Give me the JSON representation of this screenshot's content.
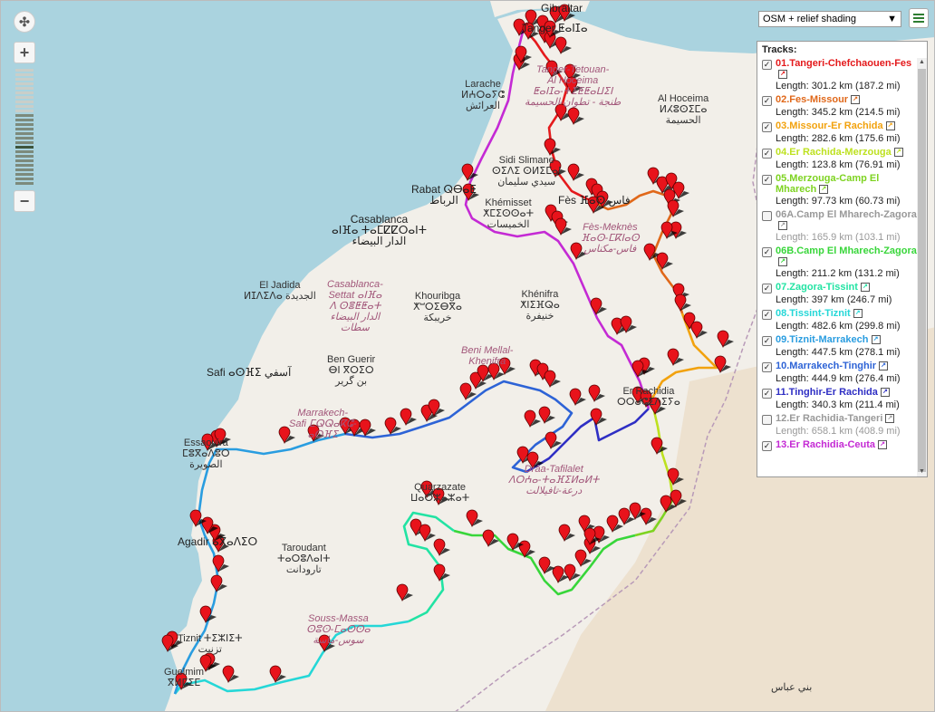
{
  "map": {
    "layer_select": "OSM + relief shading",
    "colors": {
      "sea": "#aad3df",
      "land": "#f2efe9",
      "desert": "#ebdcc3",
      "border": "#b89ab8"
    },
    "places": [
      {
        "name": "Gibraltar",
        "cls": "big"
      },
      {
        "name": "Tanger ⵟⴰⵏⵊⴰ",
        "cls": "big"
      },
      {
        "name": "Larache\nⵍⵄⵔⴰⵢⵛ\nالعرائش",
        "cls": ""
      },
      {
        "name": "Tanger-Tetouan-\nAl Hoceima\nⵟⴰⵏⵊⴰ-ⵜⵉⵟⵟⴰⵡⵉⵏ\nطنجة - تطوان-الحسيمة",
        "cls": "region"
      },
      {
        "name": "Al Hoceima\nⵍⵃⵓⵙⵉⵎⴰ\nالحسيمة",
        "cls": ""
      },
      {
        "name": "Sidi Slimane\nⵙⵉⴷⵉ ⵙⵍⵉⵎⴰⵏ\nسيدي سليمان",
        "cls": ""
      },
      {
        "name": "Rabat ⵕⴱⴰⵟ\nالرباط",
        "cls": "big"
      },
      {
        "name": "Khémisset\nⵅⵎⵉⵙⵙⴰⵜ\nالخميسات",
        "cls": ""
      },
      {
        "name": "Fès ⴼⴰⵙ فاس",
        "cls": "big"
      },
      {
        "name": "Fès-Meknès\nⴼⴰⵙ-ⵎⴽⵏⴰⵙ\nفاس-مكناس",
        "cls": "region"
      },
      {
        "name": "Casablanca\nⴰⵏⴼⴰ ⵜⴰⵎⵇⵇⵔⴰⵏⵜ\nالدار البيضاء",
        "cls": "big"
      },
      {
        "name": "El Jadida\nⵍⵊⴷⵉⴷⴰ الجديدة",
        "cls": ""
      },
      {
        "name": "Casablanca-\nSettat ⴰⵏⴼⴰ\nⴷ ⵙⴻⵟⵟⴰⵜ\nالدار البيضاء\nسطات",
        "cls": "region"
      },
      {
        "name": "Khouribga\nⵅⵯⵔⵉⴱⴳⴰ\nخريبكة",
        "cls": ""
      },
      {
        "name": "Khénifra\nⵅⵏⵉⴼⵕⴰ\nخنيفرة",
        "cls": ""
      },
      {
        "name": "Beni Mellal-\nKhenifra",
        "cls": "region"
      },
      {
        "name": "Safi ⴰⵙⴼⵉ آسفي",
        "cls": "big"
      },
      {
        "name": "Ben Guerir\nⴱⵏ ⴳⵔⵉⵔ\nبن گرير",
        "cls": ""
      },
      {
        "name": "Marrakech-\nSafi ⵎⵕⵕⴰⴽⵛ-\nⴰⵙⴼⵉ",
        "cls": "region"
      },
      {
        "name": "Er Rachidia\nⵔⵔⴰⵛⵉⴷⵉⵢⴰ",
        "cls": ""
      },
      {
        "name": "Essaouira\nⵎⵓⴳⴰⴷⵓⵔ\nالصويرة",
        "cls": ""
      },
      {
        "name": "Drâa-Tafilalet\nⴷⵔⵄⴰ-ⵜⴰⴼⵉⵍⴰⵍⵜ\nدرعة-تافيلالت",
        "cls": "region"
      },
      {
        "name": "Quarzazate\nⵡⴰⵔⵣⴰⵣⴰⵜ",
        "cls": ""
      },
      {
        "name": "Agadir ⴰⴳⴰⴷⵉⵔ",
        "cls": "big"
      },
      {
        "name": "Taroudant\nⵜⴰⵔⵓⴷⴰⵏⵜ\nتارودانت",
        "cls": ""
      },
      {
        "name": "Souss-Massa\nⵙⵓⵙ-ⵎⴰⵙⵙⴰ\nسوس-ماسة",
        "cls": "region"
      },
      {
        "name": "Tiznit ⵜⵉⵣⵏⵉⵜ\nتزنيت",
        "cls": ""
      },
      {
        "name": "Guelmim\nⴳⵍⵎⵉⵎ",
        "cls": ""
      },
      {
        "name": "بني عباس",
        "cls": ""
      }
    ]
  },
  "panel": {
    "title": "Tracks:",
    "tracks": [
      {
        "name": "01.Tangeri-Chefchaouen-Fes",
        "length": "Length: 301.2 km (187.2 mi)",
        "color": "#e41a1c",
        "checked": true
      },
      {
        "name": "02.Fes-Missour",
        "length": "Length: 345.2 km (214.5 mi)",
        "color": "#e0681a",
        "checked": true
      },
      {
        "name": "03.Missour-Er Rachida",
        "length": "Length: 282.6 km (175.6 mi)",
        "color": "#f2a20e",
        "checked": true
      },
      {
        "name": "04.Er Rachida-Merzouga",
        "length": "Length: 123.8 km (76.91 mi)",
        "color": "#bde11f",
        "checked": true
      },
      {
        "name": "05.Merzouga-Camp El Mharech",
        "length": "Length: 97.73 km (60.73 mi)",
        "color": "#7ed321",
        "checked": true
      },
      {
        "name": "06A.Camp El Mharech-Zagora",
        "length": "Length: 165.9 km (103.1 mi)",
        "color": "#999999",
        "checked": false
      },
      {
        "name": "06B.Camp El Mharech-Zagora",
        "length": "Length: 211.2 km (131.2 mi)",
        "color": "#38d63a",
        "checked": true
      },
      {
        "name": "07.Zagora-Tissint",
        "length": "Length: 397 km (246.7 mi)",
        "color": "#22e3a3",
        "checked": true
      },
      {
        "name": "08.Tissint-Tiznit",
        "length": "Length: 482.6 km (299.8 mi)",
        "color": "#25d7d7",
        "checked": true
      },
      {
        "name": "09.Tiznit-Marrakech",
        "length": "Length: 447.5 km (278.1 mi)",
        "color": "#2a9de0",
        "checked": true
      },
      {
        "name": "10.Marrakech-Tinghir",
        "length": "Length: 444.9 km (276.4 mi)",
        "color": "#2d63d6",
        "checked": true
      },
      {
        "name": "11.Tinghir-Er Rachida",
        "length": "Length: 340.3 km (211.4 mi)",
        "color": "#2f2fc4",
        "checked": true
      },
      {
        "name": "12.Er Rachidia-Tangeri",
        "length": "Length: 658.1 km (408.9 mi)",
        "color": "#999999",
        "checked": false
      },
      {
        "name": "13.Er Rachidia-Ceuta",
        "length": "",
        "color": "#c42ad4",
        "checked": true
      }
    ]
  }
}
